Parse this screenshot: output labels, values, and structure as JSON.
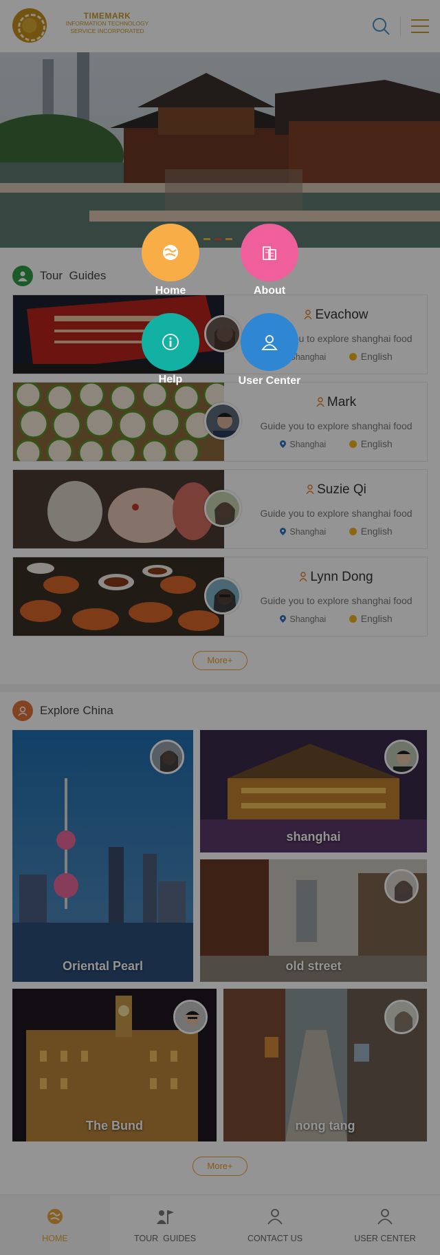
{
  "header": {
    "logo_line1": "TIMEMARK",
    "logo_line2": "INFORMATION TECHNOLOGY",
    "logo_line3": "SERVICE INCORPORATED",
    "search_icon": "search-icon",
    "menu_icon": "hamburger-menu-icon"
  },
  "banner": {
    "slides": 4,
    "active_slide": 2
  },
  "tour_guides": {
    "title": "Tour  Guides",
    "guides": [
      {
        "name": "Evachow",
        "desc": "Guide you to explore shanghai food",
        "location": "Shanghai",
        "language": "English"
      },
      {
        "name": "Mark",
        "desc": "Guide you to explore shanghai food",
        "location": "Shanghai",
        "language": "English"
      },
      {
        "name": "Suzie Qi",
        "desc": "Guide you to explore shanghai food",
        "location": "Shanghai",
        "language": "English"
      },
      {
        "name": "Lynn Dong",
        "desc": "Guide you to explore shanghai food",
        "location": "Shanghai",
        "language": "English"
      }
    ],
    "more_label": "More+"
  },
  "explore": {
    "title": "Explore China",
    "tiles": [
      {
        "label": "Oriental Pearl"
      },
      {
        "label": "shanghai"
      },
      {
        "label": "old street"
      },
      {
        "label": "The Bund"
      },
      {
        "label": "nong tang"
      }
    ],
    "more_label": "More+"
  },
  "bottom_nav": {
    "items": [
      {
        "label": "HOME",
        "active": true
      },
      {
        "label": "TOUR  GUIDES",
        "active": false
      },
      {
        "label": "CONTACT US",
        "active": false
      },
      {
        "label": "USER CENTER",
        "active": false
      }
    ]
  },
  "popup_menu": {
    "items": [
      {
        "label": "Home",
        "color": "#f9ad47"
      },
      {
        "label": "About",
        "color": "#ee5f9c"
      },
      {
        "label": "Help",
        "color": "#13b1a3"
      },
      {
        "label": "User Center",
        "color": "#2f86d3"
      }
    ]
  },
  "colors": {
    "accent": "#e8a63a",
    "overlay": "rgba(0,0,0,0.42)"
  }
}
